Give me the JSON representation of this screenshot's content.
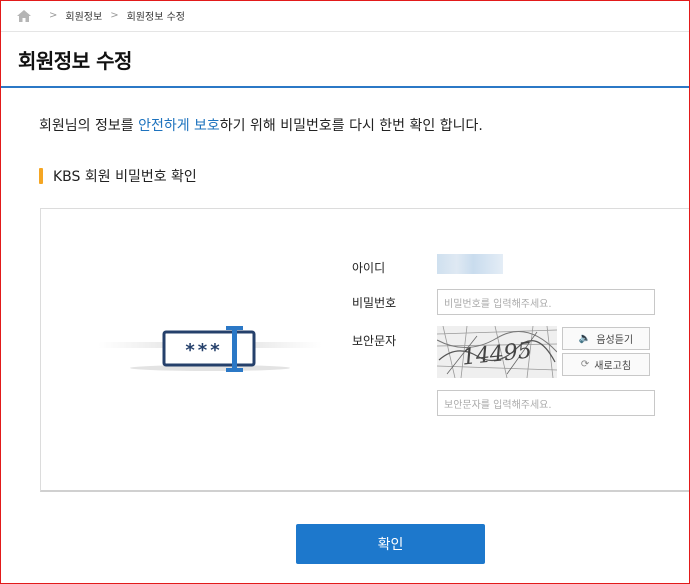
{
  "breadcrumb": {
    "items": [
      "회원정보",
      "회원정보 수정"
    ]
  },
  "page": {
    "title": "회원정보 수정"
  },
  "intro": {
    "before": "회원님의 정보를 ",
    "highlight": "안전하게 보호",
    "after": "하기 위해 비밀번호를 다시 한번 확인 합니다."
  },
  "section": {
    "title": "KBS 회원 비밀번호 확인"
  },
  "illustration": {
    "text": "***"
  },
  "form": {
    "id_label": "아이디",
    "password_label": "비밀번호",
    "password_placeholder": "비밀번호를 입력해주세요.",
    "captcha_label": "보안문자",
    "captcha_text": "14495",
    "audio_button": "음성듣기",
    "refresh_button": "새로고침",
    "captcha_placeholder": "보안문자를 입력해주세요."
  },
  "submit": {
    "label": "확인"
  },
  "colors": {
    "accent": "#1d78cc",
    "section_bar": "#f5a623",
    "frame": "#e21a1a"
  }
}
